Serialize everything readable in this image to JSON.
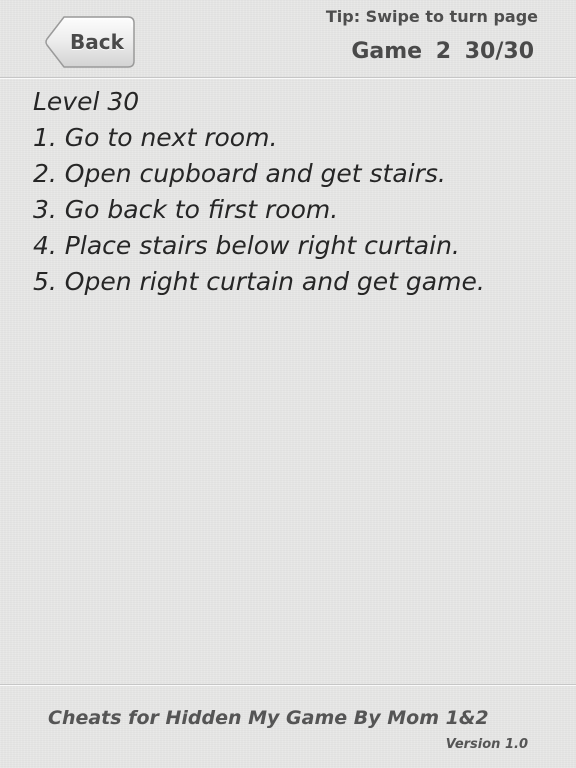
{
  "header": {
    "back_label": "Back",
    "tip": "Tip: Swipe to turn page",
    "game_label": "Game 2",
    "page_counter": "30/30"
  },
  "content": {
    "lines": [
      "Level 30",
      "1. Go to next room.",
      "2. Open cupboard and get stairs.",
      "3. Go back to first room.",
      "4. Place stairs below right curtain.",
      "5. Open right curtain and get game."
    ]
  },
  "footer": {
    "title": "Cheats for Hidden My Game By Mom 1&2",
    "version": "Version 1.0"
  },
  "colors": {
    "background": "#e7e7e6",
    "divider": "#c6c6c6",
    "text": "#262626",
    "header_text": "#4a4a4a",
    "footer_text": "#555555"
  }
}
